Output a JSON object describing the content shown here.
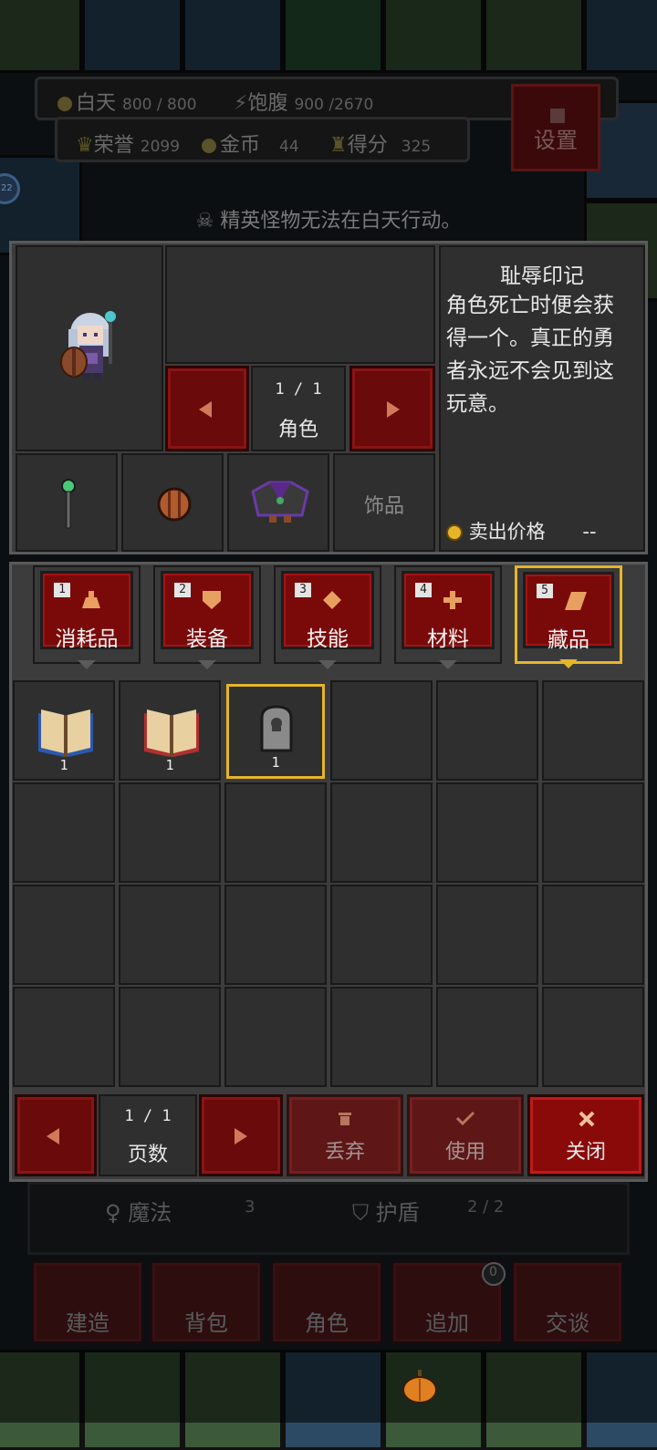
{
  "hud": {
    "day_label": "白天",
    "day_value": "800 / 800",
    "satiety_label": "饱腹",
    "satiety_value": "900 /2670",
    "honor_label": "荣誉",
    "honor_value": "2099",
    "gold_label": "金币",
    "gold_value": "44",
    "score_label": "得分",
    "score_value": "325",
    "settings_label": "设置",
    "side_badge": "22"
  },
  "notice": "精英怪物无法在白天行动。",
  "character": {
    "page": "1 / 1",
    "label": "角色",
    "slot_accessory_label": "饰品"
  },
  "item_detail": {
    "name": "耻辱印记",
    "description_lines": [
      "角色死亡时便会获",
      "得一个。真正的勇",
      "者永远不会见到这",
      "玩意。"
    ],
    "sell_label": "卖出价格",
    "sell_value": "--"
  },
  "tabs": [
    {
      "num": "1",
      "label": "消耗品",
      "icon": "potion-icon"
    },
    {
      "num": "2",
      "label": "装备",
      "icon": "shield-icon"
    },
    {
      "num": "3",
      "label": "技能",
      "icon": "diamond-icon"
    },
    {
      "num": "4",
      "label": "材料",
      "icon": "plus-icon"
    },
    {
      "num": "5",
      "label": "藏品",
      "icon": "scroll-icon"
    }
  ],
  "inventory": [
    {
      "icon": "blue-book-icon",
      "qty": "1"
    },
    {
      "icon": "red-book-icon",
      "qty": "1"
    },
    {
      "icon": "tombstone-icon",
      "qty": "1"
    }
  ],
  "footer": {
    "page": "1 / 1",
    "page_label": "页数",
    "discard_label": "丢弃",
    "use_label": "使用",
    "close_label": "关闭"
  },
  "underlay": {
    "magic_label": "魔法",
    "magic_value": "3",
    "shield_label": "护盾",
    "shield_value": "2 / 2",
    "nav": [
      "建造",
      "背包",
      "角色",
      "追加",
      "交谈"
    ],
    "badge": "0"
  },
  "colors": {
    "accent_gold": "#e6b52a",
    "button_red": "#7a0a0a",
    "panel_gray": "#3c3c3c"
  }
}
